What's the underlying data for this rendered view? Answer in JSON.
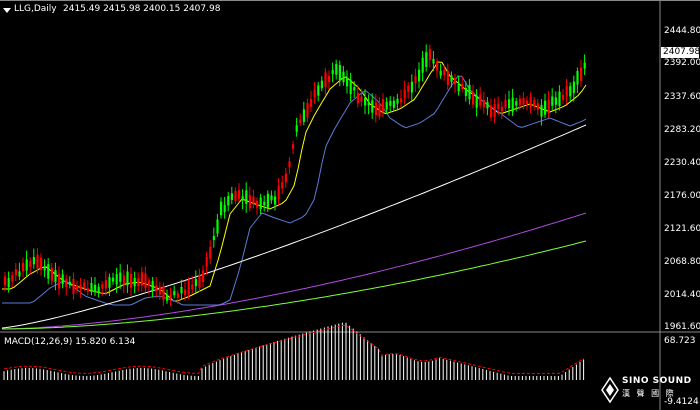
{
  "header": {
    "symbol": "LLG,Daily",
    "ohlc": "2415.49 2415.98 2400.15 2407.98"
  },
  "price_axis": {
    "labels": [
      "2444.80",
      "2392.00",
      "2337.60",
      "2283.20",
      "2230.40",
      "2176.00",
      "2121.60",
      "2068.80",
      "2014.40",
      "1961.60"
    ],
    "current_price": "2407.98"
  },
  "macd": {
    "label": "MACD(12,26,9) 15.820 6.134",
    "axis_top": "68.723",
    "axis_bottom": "-9.4124"
  },
  "logo": {
    "name": "SINO SOUND",
    "cn": "漢 聲 國 際"
  },
  "colors": {
    "background": "#000000",
    "bull_candle": "#ff0000",
    "bear_candle": "#00ff00",
    "ma_fast": "#ffff00",
    "ma_mid": "#5b7bd5",
    "ma_slow": "#ffffff",
    "ma_long": "#b04ce0",
    "ma_longest": "#7cff3a",
    "macd_hist": "#ffffff",
    "macd_signal": "#ff0000"
  }
}
